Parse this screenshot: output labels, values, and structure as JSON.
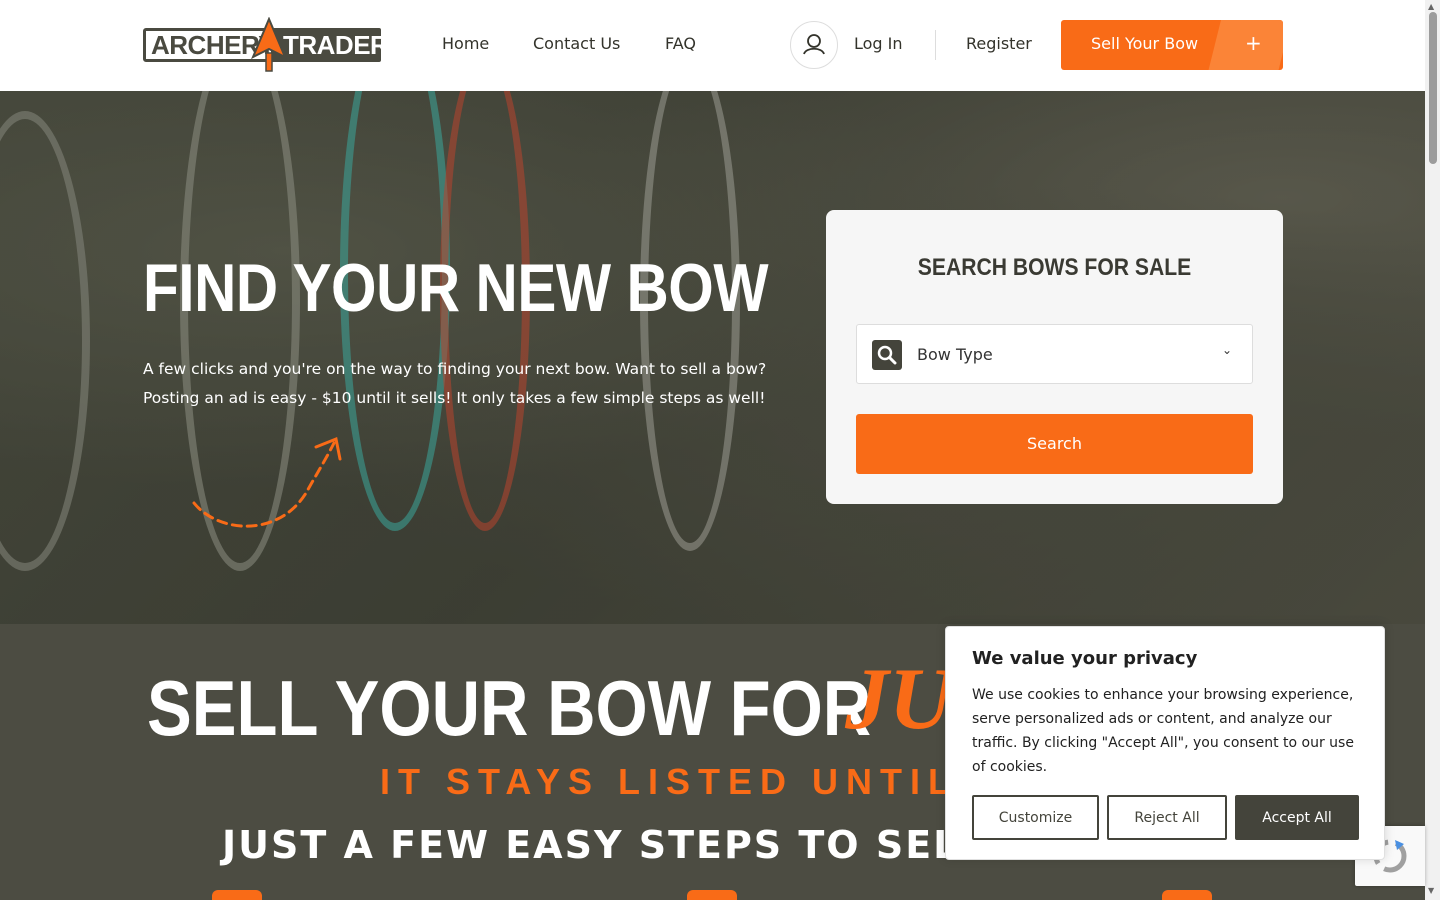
{
  "header": {
    "logo": {
      "left": "ARCHERY",
      "right": "TRADER"
    },
    "nav": {
      "home": "Home",
      "contact": "Contact Us",
      "faq": "FAQ"
    },
    "login": "Log In",
    "register": "Register",
    "sell_button": {
      "label": "Sell Your Bow",
      "icon": "+"
    }
  },
  "hero": {
    "title": "FIND YOUR NEW BOW",
    "subtitle": "A few clicks and you're on the way to finding your next bow. Want to sell a bow? Posting an ad is easy - $10 until it sells! It only takes a few simple steps as well!"
  },
  "search_card": {
    "title": "SEARCH BOWS FOR SALE",
    "select_value": "Bow Type",
    "chevron": "⌄",
    "button": "Search"
  },
  "sell_section": {
    "title": "SELL YOUR BOW FOR",
    "accent": "JU",
    "stays": "IT STAYS LISTED UNTIL IT",
    "steps_title": "JUST A FEW EASY STEPS TO SELL"
  },
  "cookie": {
    "title": "We value your privacy",
    "text": "We use cookies to enhance your browsing experience, serve personalized ads or content, and analyze our traffic. By clicking \"Accept All\", you consent to our use of cookies.",
    "customize": "Customize",
    "reject": "Reject All",
    "accept": "Accept All"
  },
  "colors": {
    "accent": "#f96b17",
    "dark": "#4c4c42"
  }
}
